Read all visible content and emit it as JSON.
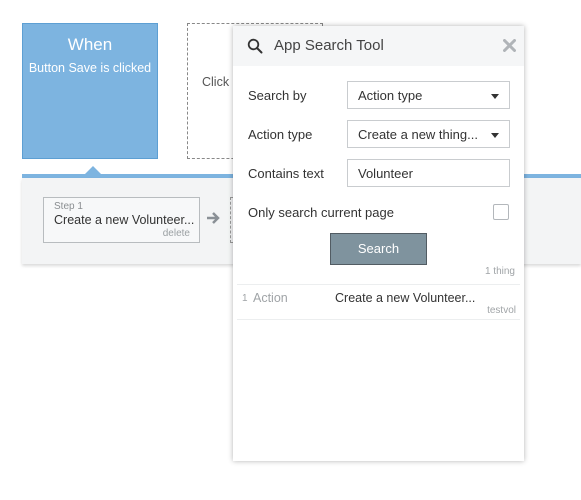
{
  "workflow": {
    "event_title": "When",
    "event_subtitle": "Button Save is clicked",
    "add_event_text": "Click h",
    "step": {
      "label": "Step 1",
      "name": "Create a new Volunteer...",
      "delete_label": "delete"
    }
  },
  "search_tool": {
    "title": "App Search Tool",
    "search_by_label": "Search by",
    "search_by_value": "Action type",
    "action_type_label": "Action type",
    "action_type_value": "Create a new thing...",
    "contains_text_label": "Contains text",
    "contains_text_value": "Volunteer",
    "only_current_page_label": "Only search current page",
    "only_current_page_checked": false,
    "search_button_label": "Search",
    "result_count": "1 thing",
    "results": [
      {
        "index": "1",
        "type": "Action",
        "name": "Create a new Volunteer...",
        "page": "testvol"
      }
    ]
  },
  "colors": {
    "event_blue": "#7db4e0",
    "search_button": "#7f939e"
  }
}
